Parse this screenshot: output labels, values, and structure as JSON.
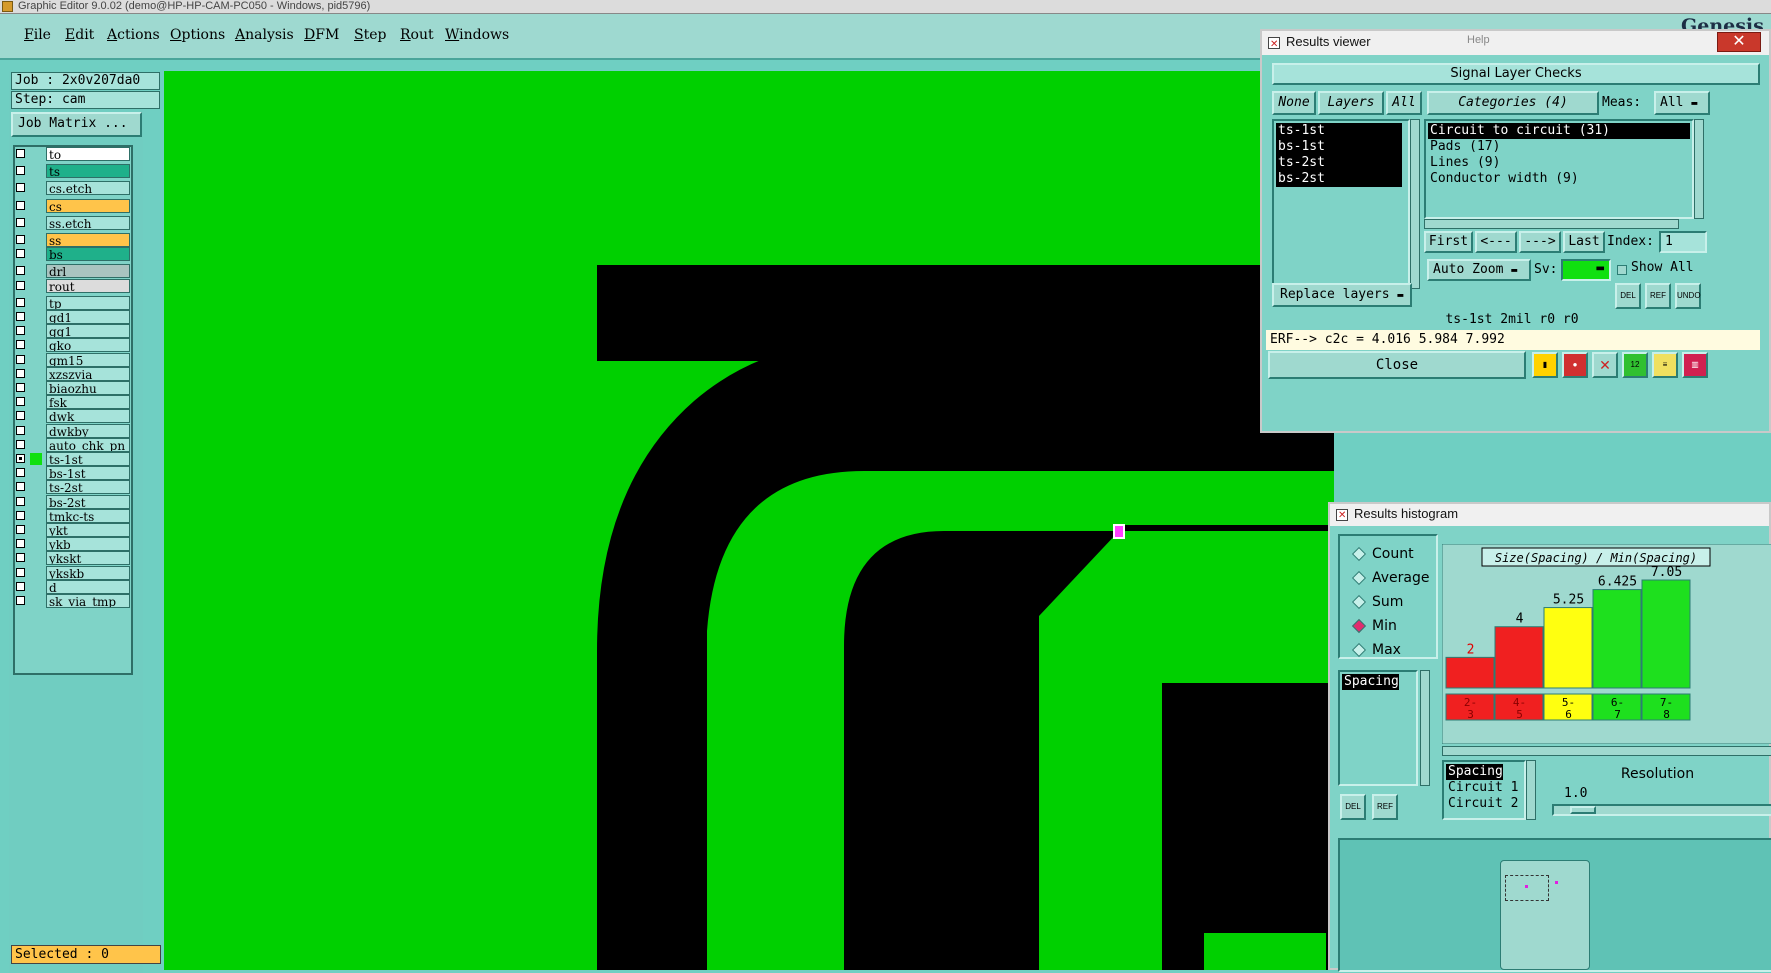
{
  "window": {
    "title": "Graphic Editor 9.0.02 (demo@HP-HP-CAM-PC050 - Windows, pid5796)"
  },
  "menu": {
    "items": [
      "File",
      "Edit",
      "Actions",
      "Options",
      "Analysis",
      "DFM",
      "Step",
      "Rout",
      "Windows"
    ]
  },
  "brand": {
    "logo": "Genesis"
  },
  "job": {
    "job_line": "Job : 2x0v207da0",
    "step_line": "Step: cam",
    "matrix_button": "Job Matrix ..."
  },
  "layers": [
    {
      "name": "to",
      "color": "#ffffff",
      "checked": false
    },
    {
      "name": "ts",
      "color": "#1fb08a",
      "checked": false
    },
    {
      "name": "cs.etch",
      "color": "#a6e3da",
      "checked": false
    },
    {
      "name": "cs",
      "color": "#ffc44a",
      "checked": false
    },
    {
      "name": "ss.etch",
      "color": "#a6e3da",
      "checked": false
    },
    {
      "name": "ss",
      "color": "#ffc44a",
      "checked": false
    },
    {
      "name": "bs",
      "color": "#1fb08a",
      "checked": false
    },
    {
      "name": "drl",
      "color": "#a9c4c0",
      "checked": false
    },
    {
      "name": "rout",
      "color": "#dcdcdc",
      "checked": false
    },
    {
      "name": "tp",
      "color": "#a6e3da",
      "checked": false
    },
    {
      "name": "gd1",
      "color": "#a6e3da",
      "checked": false
    },
    {
      "name": "gg1",
      "color": "#a6e3da",
      "checked": false
    },
    {
      "name": "gko",
      "color": "#a6e3da",
      "checked": false
    },
    {
      "name": "gm15",
      "color": "#a6e3da",
      "checked": false
    },
    {
      "name": "xzszvia",
      "color": "#a6e3da",
      "checked": false
    },
    {
      "name": "biaozhu",
      "color": "#a6e3da",
      "checked": false
    },
    {
      "name": "fsk",
      "color": "#a6e3da",
      "checked": false
    },
    {
      "name": "dwk",
      "color": "#a6e3da",
      "checked": false
    },
    {
      "name": "dwkby",
      "color": "#a6e3da",
      "checked": false
    },
    {
      "name": "auto_chk_pn",
      "color": "#a6e3da",
      "checked": false
    },
    {
      "name": "ts-1st",
      "color": "#a6e3da",
      "checked": true
    },
    {
      "name": "bs-1st",
      "color": "#a6e3da",
      "checked": false
    },
    {
      "name": "ts-2st",
      "color": "#a6e3da",
      "checked": false
    },
    {
      "name": "bs-2st",
      "color": "#a6e3da",
      "checked": false
    },
    {
      "name": "tmkc-ts",
      "color": "#a6e3da",
      "checked": false
    },
    {
      "name": "ykt",
      "color": "#a6e3da",
      "checked": false
    },
    {
      "name": "ykb",
      "color": "#a6e3da",
      "checked": false
    },
    {
      "name": "ykskt",
      "color": "#a6e3da",
      "checked": false
    },
    {
      "name": "ykskb",
      "color": "#a6e3da",
      "checked": false
    },
    {
      "name": "d",
      "color": "#a6e3da",
      "checked": false
    },
    {
      "name": "sk_via_tmp",
      "color": "#a6e3da",
      "checked": false
    }
  ],
  "status": {
    "selected": "Selected : 0"
  },
  "results_viewer": {
    "title": "Results viewer",
    "help": "Help",
    "section": "Signal Layer Checks",
    "none_btn": "None",
    "layers_btn": "Layers",
    "all_btn": "All",
    "categories_btn": "Categories (4)",
    "meas_label": "Meas:",
    "meas_value": "All",
    "layer_items": [
      "ts-1st",
      "bs-1st",
      "ts-2st",
      "bs-2st"
    ],
    "category_items": [
      "Circuit to circuit (31)",
      "Pads (17)",
      "Lines (9)",
      "Conductor width (9)"
    ],
    "first_btn": "First",
    "prev_btn": "<---",
    "next_btn": "--->",
    "last_btn": "Last",
    "index_label": "Index:",
    "index_value": "1",
    "auto_zoom": "Auto Zoom",
    "sv_label": "Sv:",
    "show_all": "Show All",
    "replace_layers": "Replace layers",
    "del": "DEL",
    "ref": "REF",
    "undo": "UNDO",
    "info_line": "ts-1st 2mil  r0  r0",
    "erf_line": "ERF--> c2c = 4.016 5.984 7.992",
    "close_btn": "Close"
  },
  "histogram": {
    "title": "Results histogram",
    "modes": [
      "Count",
      "Average",
      "Sum",
      "Min",
      "Max"
    ],
    "selected_mode": "Min",
    "list_item": "Spacing",
    "attr_items": [
      "Spacing",
      "Circuit 1",
      "Circuit 2"
    ],
    "resolution_label": "Resolution",
    "resolution_value": "1.0",
    "del": "DEL",
    "ref": "REF"
  },
  "chart_data": {
    "type": "bar",
    "title": "Size(Spacing) / Min(Spacing)",
    "categories": [
      "2-3",
      "4-5",
      "5-6",
      "6-7",
      "7-8"
    ],
    "values": [
      2,
      4,
      5.25,
      6.425,
      7.05
    ],
    "labels": [
      "2",
      "4",
      "5.25",
      "6.425",
      "7.05"
    ],
    "colors": [
      "#f02020",
      "#f02020",
      "#ffff10",
      "#1ee01e",
      "#1ee01e"
    ],
    "ylim": [
      0,
      7.05
    ]
  }
}
